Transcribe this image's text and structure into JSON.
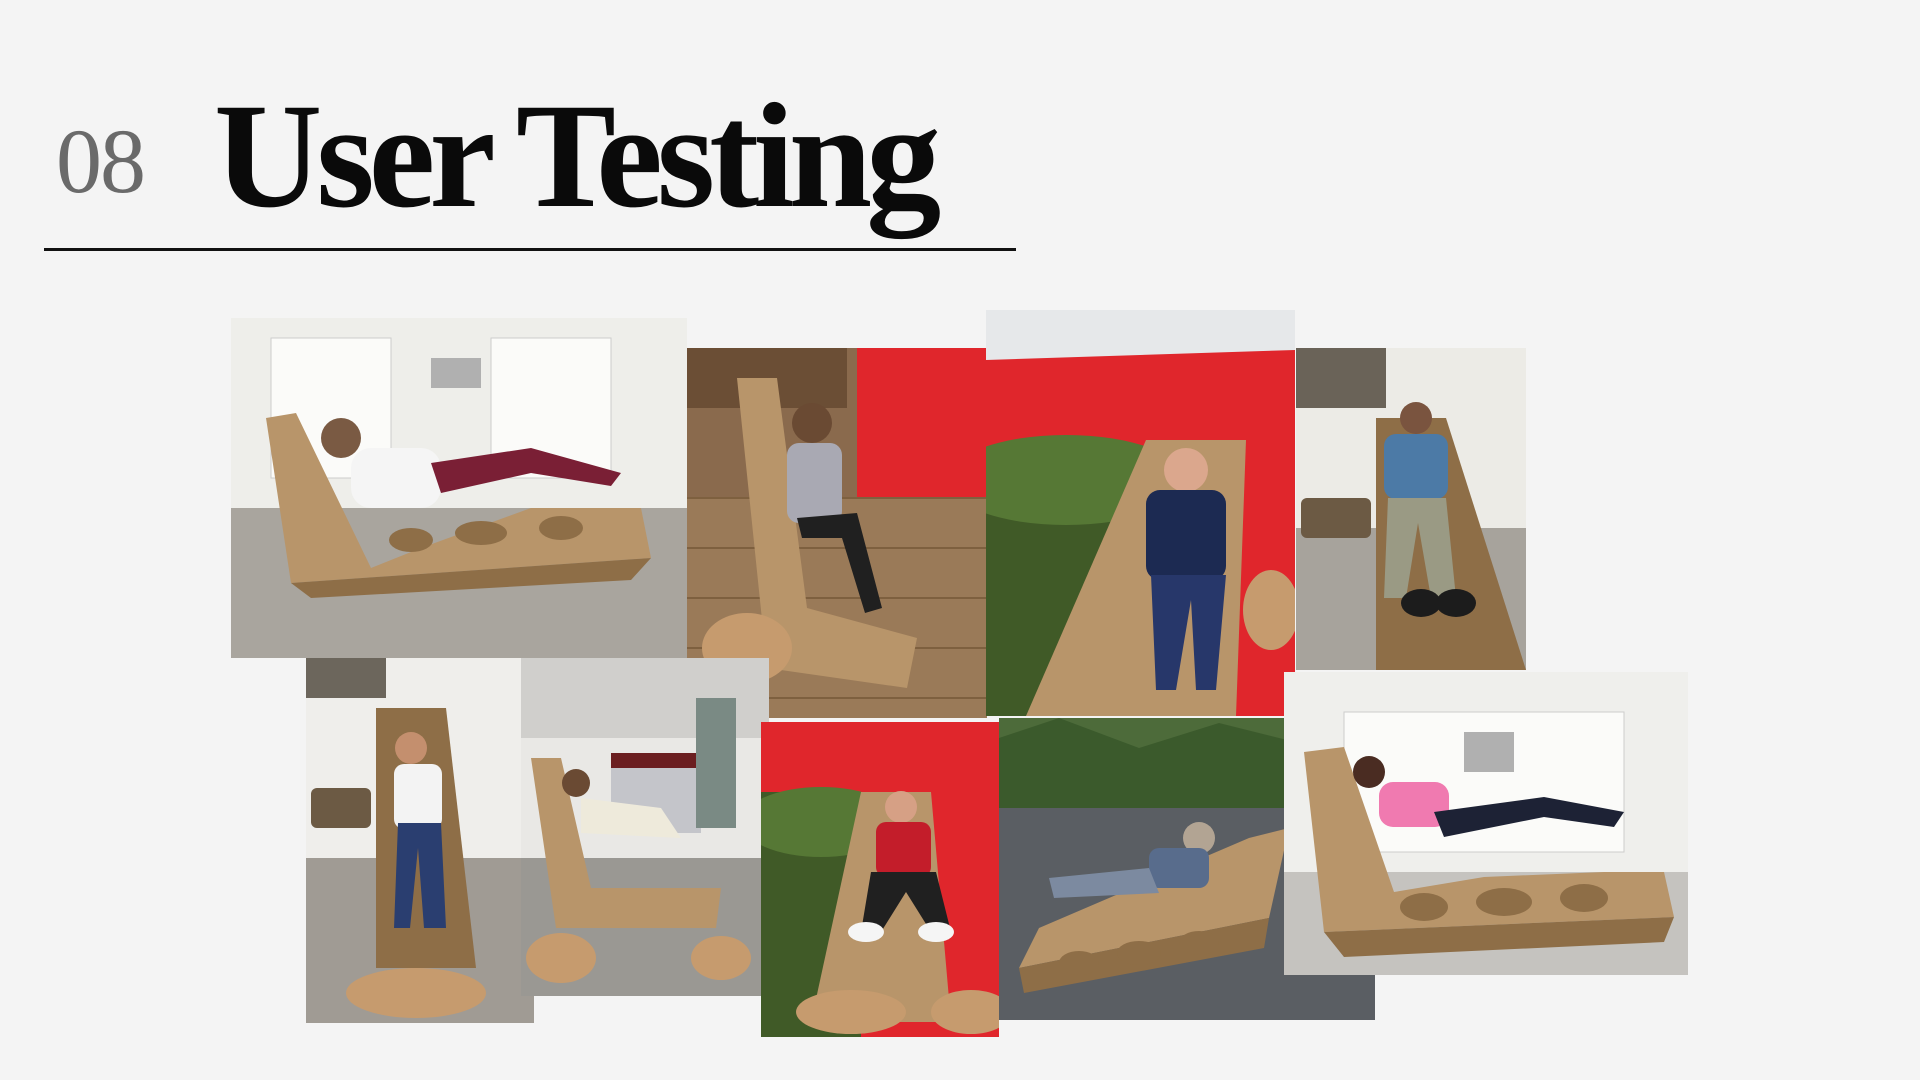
{
  "slide": {
    "number": "08",
    "title": "User Testing"
  },
  "photos": [
    {
      "id": "p1",
      "scene": "white-office",
      "pose": "reclining"
    },
    {
      "id": "p2",
      "scene": "red-booth",
      "pose": "sitting"
    },
    {
      "id": "p3",
      "scene": "red-tent",
      "pose": "suit-reclining"
    },
    {
      "id": "p4",
      "scene": "white-corner",
      "pose": "lying-front"
    },
    {
      "id": "p5",
      "scene": "white-corner",
      "pose": "lying-front"
    },
    {
      "id": "p6",
      "scene": "exhibition",
      "pose": "reclining"
    },
    {
      "id": "p7",
      "scene": "red-tent",
      "pose": "lying-front"
    },
    {
      "id": "p8",
      "scene": "outdoor",
      "pose": "reclining"
    },
    {
      "id": "p9",
      "scene": "white-office",
      "pose": "reclining"
    }
  ],
  "colors": {
    "background": "#f4f4f4",
    "cardboard": "#b8956a",
    "cardboard_dark": "#8e6e47",
    "tent_red": "#e0262c",
    "office_white": "#eeeeea",
    "floor_grey": "#a7a39c"
  }
}
